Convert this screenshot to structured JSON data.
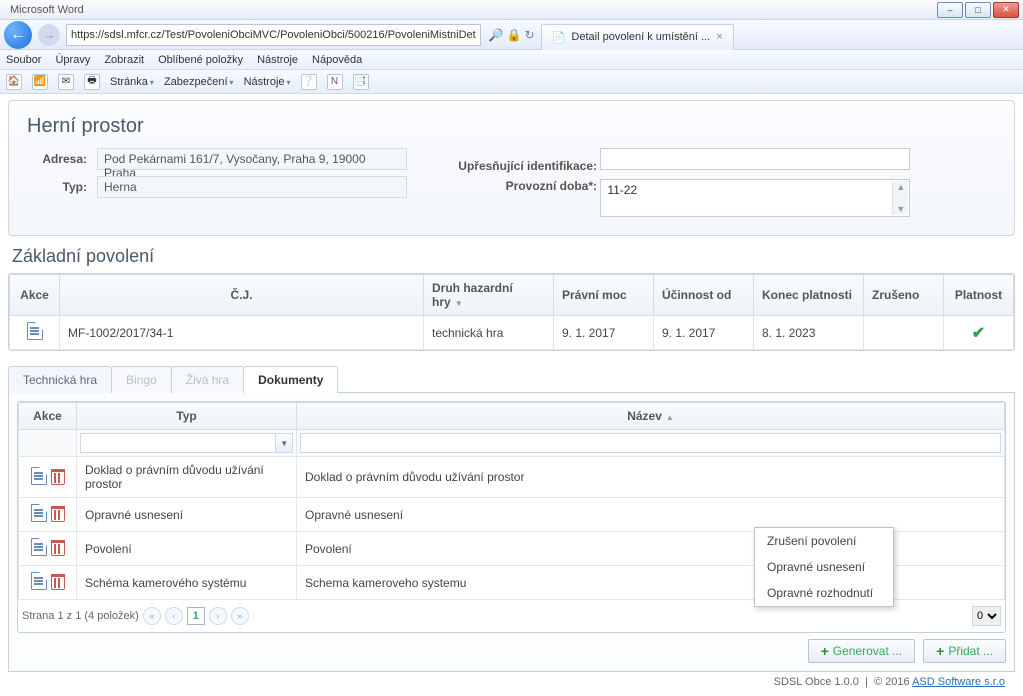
{
  "window": {
    "title_hint": "Microsoft Word",
    "tab_title": "Detail povolení k umístění ...",
    "url": "https://sdsl.mfcr.cz/Test/PovoleniObciMVC/PovoleniObci/500216/PovoleniMistniDet"
  },
  "menubar": [
    "Soubor",
    "Úpravy",
    "Zobrazit",
    "Oblíbené položky",
    "Nástroje",
    "Nápověda"
  ],
  "toolbar": {
    "items": [
      "Stránka",
      "Zabezpečení",
      "Nástroje"
    ]
  },
  "panel": {
    "title": "Herní prostor",
    "adresa_label": "Adresa:",
    "adresa_value": "Pod Pekárnami 161/7, Vysočany, Praha 9, 19000 Praha",
    "typ_label": "Typ:",
    "typ_value": "Herna",
    "ident_label": "Upřesňující identifikace:",
    "ident_value": "",
    "doba_label": "Provozní doba*:",
    "doba_value": "11-22"
  },
  "permits": {
    "title": "Základní povolení",
    "headers": {
      "akce": "Akce",
      "cj": "Č.J.",
      "druh": "Druh hazardní hry",
      "moc": "Právní moc",
      "ucinnost": "Účinnost od",
      "konec": "Konec platnosti",
      "zruseno": "Zrušeno",
      "platnost": "Platnost"
    },
    "rows": [
      {
        "cj": "MF-1002/2017/34-1",
        "druh": "technická hra",
        "moc": "9. 1. 2017",
        "ucinnost": "9. 1. 2017",
        "konec": "8. 1. 2023",
        "zruseno": "",
        "platnost": true
      }
    ]
  },
  "tabs": {
    "tech": "Technická hra",
    "bingo": "Bingo",
    "ziva": "Živá hra",
    "dokumenty": "Dokumenty"
  },
  "docs": {
    "headers": {
      "akce": "Akce",
      "typ": "Typ",
      "nazev": "Název"
    },
    "rows": [
      {
        "typ": "Doklad o právním důvodu užívání prostor",
        "nazev": "Doklad o právním důvodu užívání prostor"
      },
      {
        "typ": "Opravné usnesení",
        "nazev": "Opravné usnesení"
      },
      {
        "typ": "Povolení",
        "nazev": "Povolení"
      },
      {
        "typ": "Schéma kamerového systému",
        "nazev": "Schema kameroveho systemu"
      }
    ],
    "pager_text": "Strana 1 z 1 (4 položek)",
    "page_current": "1",
    "pagesize": "0"
  },
  "context_menu": {
    "items": [
      "Zrušení povolení",
      "Opravné usnesení",
      "Opravné rozhodnutí"
    ]
  },
  "buttons": {
    "generovat": "Generovat ...",
    "pridat": "Přidat ..."
  },
  "footer": {
    "app": "SDSL Obce 1.0.0",
    "copyright": "© 2016",
    "vendor": "ASD Software s.r.o"
  }
}
